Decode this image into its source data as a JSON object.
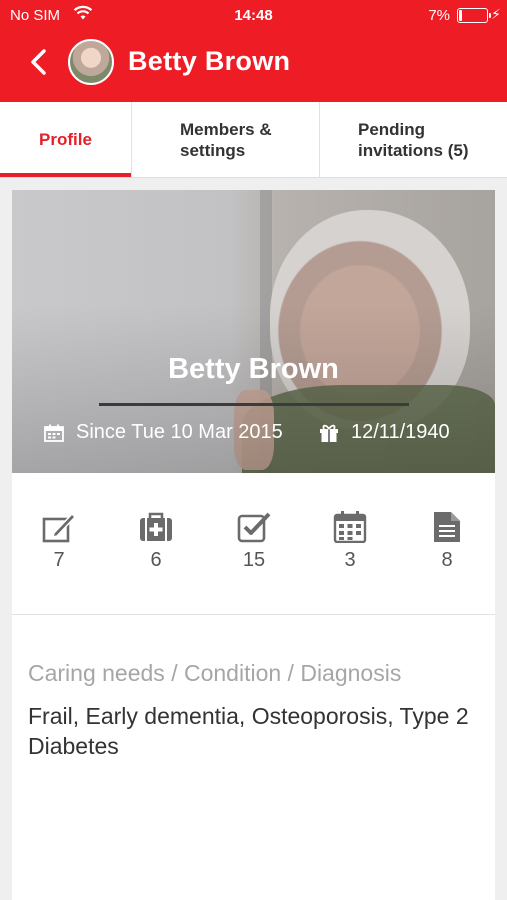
{
  "status_bar": {
    "carrier": "No SIM",
    "time": "14:48",
    "battery": "7%",
    "battery_level": 0.07
  },
  "header": {
    "title": "Betty Brown"
  },
  "tabs": [
    {
      "label": "Profile"
    },
    {
      "label": "Members & settings"
    },
    {
      "label": "Pending invitations (5)"
    }
  ],
  "profile": {
    "name": "Betty Brown",
    "since": "Since Tue 10 Mar 2015",
    "birthday": "12/11/1940"
  },
  "stats": [
    {
      "icon": "edit-note-icon",
      "count": "7"
    },
    {
      "icon": "medical-kit-icon",
      "count": "6"
    },
    {
      "icon": "checkbox-icon",
      "count": "15"
    },
    {
      "icon": "calendar-icon",
      "count": "3"
    },
    {
      "icon": "document-icon",
      "count": "8"
    }
  ],
  "caring_needs": {
    "label": "Caring needs / Condition / Diagnosis",
    "value": "Frail, Early dementia, Osteoporosis, Type 2 Diabetes"
  },
  "colors": {
    "accent": "#ee1c25",
    "tab_active": "#e4202a",
    "icon_gray": "#6b6b6b"
  }
}
